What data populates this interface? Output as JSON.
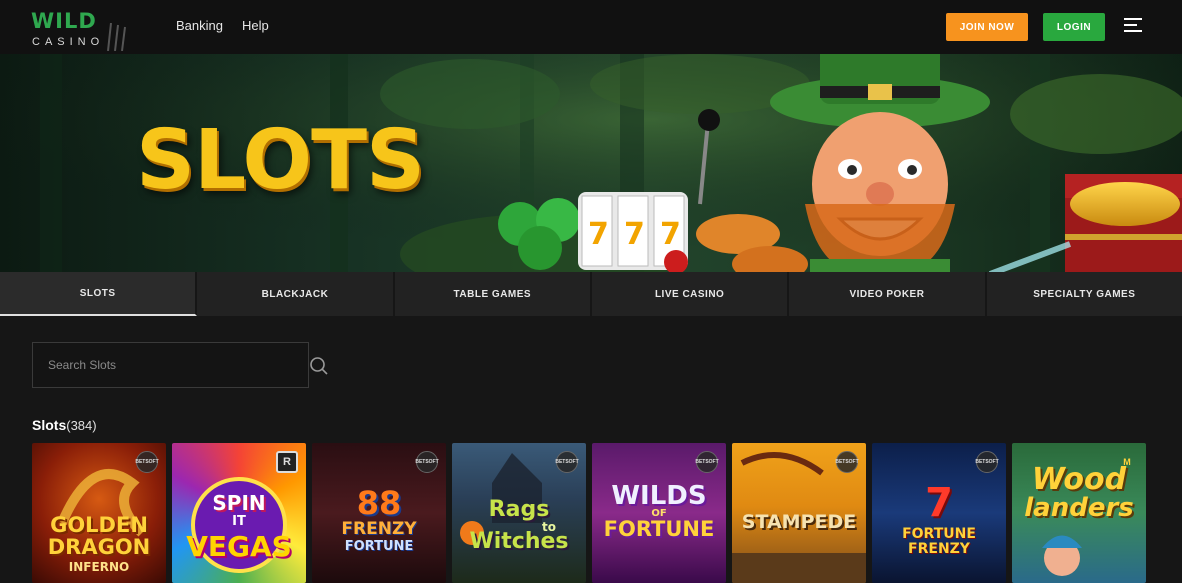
{
  "header": {
    "logo_top": "WILD",
    "logo_bottom": "CASINO",
    "nav": [
      "Banking",
      "Help"
    ],
    "join_label": "JOIN NOW",
    "login_label": "LOGIN"
  },
  "hero": {
    "title": "SLOTS"
  },
  "tabs": [
    {
      "label": "SLOTS",
      "active": true
    },
    {
      "label": "BLACKJACK",
      "active": false
    },
    {
      "label": "TABLE GAMES",
      "active": false
    },
    {
      "label": "LIVE CASINO",
      "active": false
    },
    {
      "label": "VIDEO POKER",
      "active": false
    },
    {
      "label": "SPECIALTY GAMES",
      "active": false
    }
  ],
  "search": {
    "placeholder": "Search Slots"
  },
  "section": {
    "title": "Slots",
    "count": "(384)"
  },
  "games": [
    {
      "line1": "GOLDEN",
      "line2": "DRAGON",
      "line3": "INFERNO",
      "badge": "BETSOFT"
    },
    {
      "line1": "SPIN",
      "line2": "IT",
      "line3": "VEGAS",
      "badge": "R"
    },
    {
      "line1": "88",
      "line2": "FRENZY",
      "line3": "FORTUNE",
      "badge": "BETSOFT"
    },
    {
      "line1": "Rags",
      "line2": "to",
      "line3": "Witches",
      "badge": "BETSOFT"
    },
    {
      "line1": "WILDS",
      "line2": "OF",
      "line3": "FORTUNE",
      "badge": "BETSOFT"
    },
    {
      "line1": "STAMPEDE",
      "line2": "",
      "line3": "",
      "badge": "BETSOFT"
    },
    {
      "line1": "7",
      "line2": "FORTUNE",
      "line3": "FRENZY",
      "badge": "BETSOFT"
    },
    {
      "line1": "Wood",
      "line2": "landers",
      "line3": "",
      "badge": "M"
    }
  ],
  "colors": {
    "join": "#f7931e",
    "login": "#29a83e",
    "brand_green": "#2fa84f",
    "hero_title": "#f7c51a"
  }
}
